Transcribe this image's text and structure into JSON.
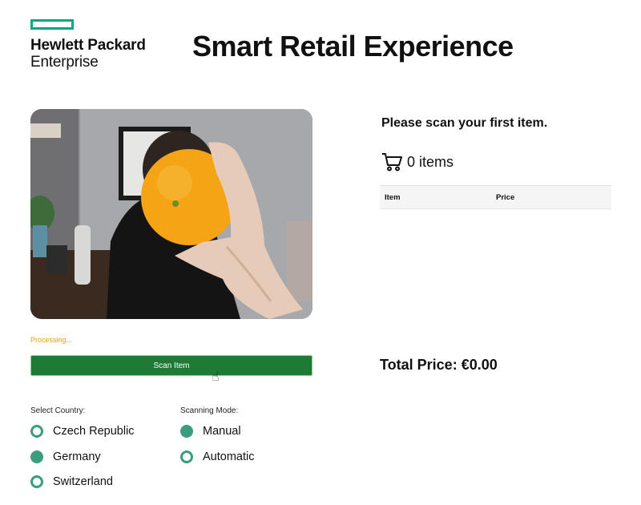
{
  "header": {
    "logo_line1": "Hewlett Packard",
    "logo_line2": "Enterprise",
    "brand_color": "#01a982",
    "title": "Smart Retail Experience"
  },
  "scanner": {
    "status_text": "Processing...",
    "scan_button_label": "Scan Item",
    "button_color": "#1e7a34"
  },
  "country": {
    "label": "Select Country:",
    "options": [
      "Czech Republic",
      "Germany",
      "Switzerland"
    ],
    "selected": "Germany"
  },
  "mode": {
    "label": "Scanning Mode:",
    "options": [
      "Manual",
      "Automatic"
    ],
    "selected": "Manual"
  },
  "cart": {
    "prompt": "Please scan your first item.",
    "count_text": "0 items",
    "columns": [
      "Item",
      "Price"
    ],
    "total_text": "Total Price: €0.00"
  }
}
